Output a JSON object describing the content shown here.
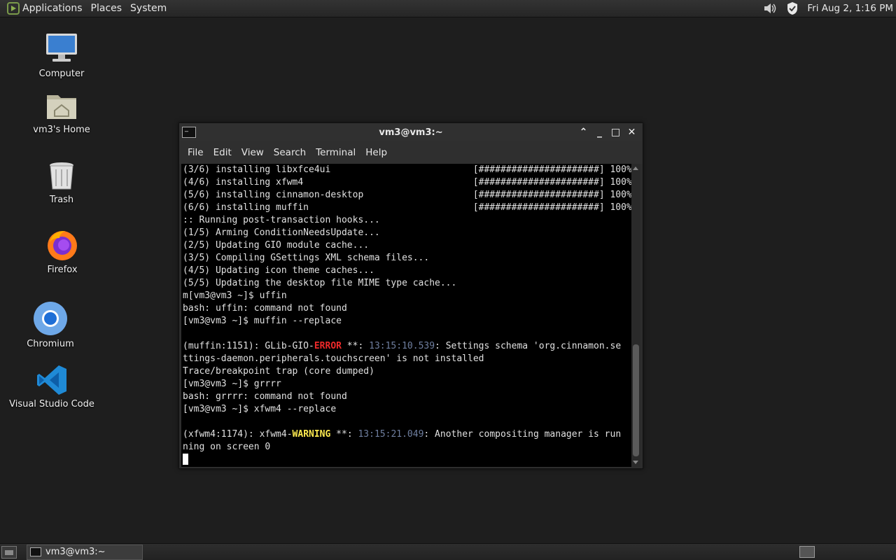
{
  "top_panel": {
    "menus": [
      "Applications",
      "Places",
      "System"
    ],
    "tray_icons": [
      "volume-icon",
      "shield-check-icon"
    ],
    "clock": "Fri Aug  2, 1:16 PM"
  },
  "desktop": {
    "icons": [
      {
        "label": "Computer",
        "icon": "monitor-icon"
      },
      {
        "label": "vm3's Home",
        "icon": "home-folder-icon"
      },
      {
        "label": "Trash",
        "icon": "trash-icon"
      },
      {
        "label": "Firefox",
        "icon": "firefox-icon"
      },
      {
        "label": "Chromium",
        "icon": "chromium-icon"
      },
      {
        "label": "Visual Studio Code",
        "icon": "vscode-icon"
      }
    ]
  },
  "terminal_window": {
    "title": "vm3@vm3:~",
    "controls": {
      "up": "⌃",
      "minimize": "_",
      "maximize": "□",
      "close": "✕"
    },
    "menu": [
      "File",
      "Edit",
      "View",
      "Search",
      "Terminal",
      "Help"
    ],
    "lines": [
      "(3/6) installing libxfce4ui                          [######################] 100%",
      "(4/6) installing xfwm4                               [######################] 100%",
      "(5/6) installing cinnamon-desktop                    [######################] 100%",
      "(6/6) installing muffin                              [######################] 100%",
      ":: Running post-transaction hooks...",
      "(1/5) Arming ConditionNeedsUpdate...",
      "(2/5) Updating GIO module cache...",
      "(3/5) Compiling GSettings XML schema files...",
      "(4/5) Updating icon theme caches...",
      "(5/5) Updating the desktop file MIME type cache...",
      "m[vm3@vm3 ~]$ uffin",
      "bash: uffin: command not found",
      "[vm3@vm3 ~]$ muffin --replace",
      "",
      {
        "pre": "(muffin:1151): GLib-GIO-",
        "hl": "ERROR",
        "hl_type": "err",
        "mid": " **: ",
        "ts": "13:15:10.539",
        "post": ": Settings schema 'org.cinnamon.se"
      },
      "ttings-daemon.peripherals.touchscreen' is not installed",
      "Trace/breakpoint trap (core dumped)",
      "[vm3@vm3 ~]$ grrrr",
      "bash: grrrr: command not found",
      "[vm3@vm3 ~]$ xfwm4 --replace",
      "",
      {
        "pre": "(xfwm4:1174): xfwm4-",
        "hl": "WARNING",
        "hl_type": "warn",
        "mid": " **: ",
        "ts": "13:15:21.049",
        "post": ": Another compositing manager is run"
      },
      "ning on screen 0"
    ]
  },
  "bottom_panel": {
    "task_title": "vm3@vm3:~"
  }
}
